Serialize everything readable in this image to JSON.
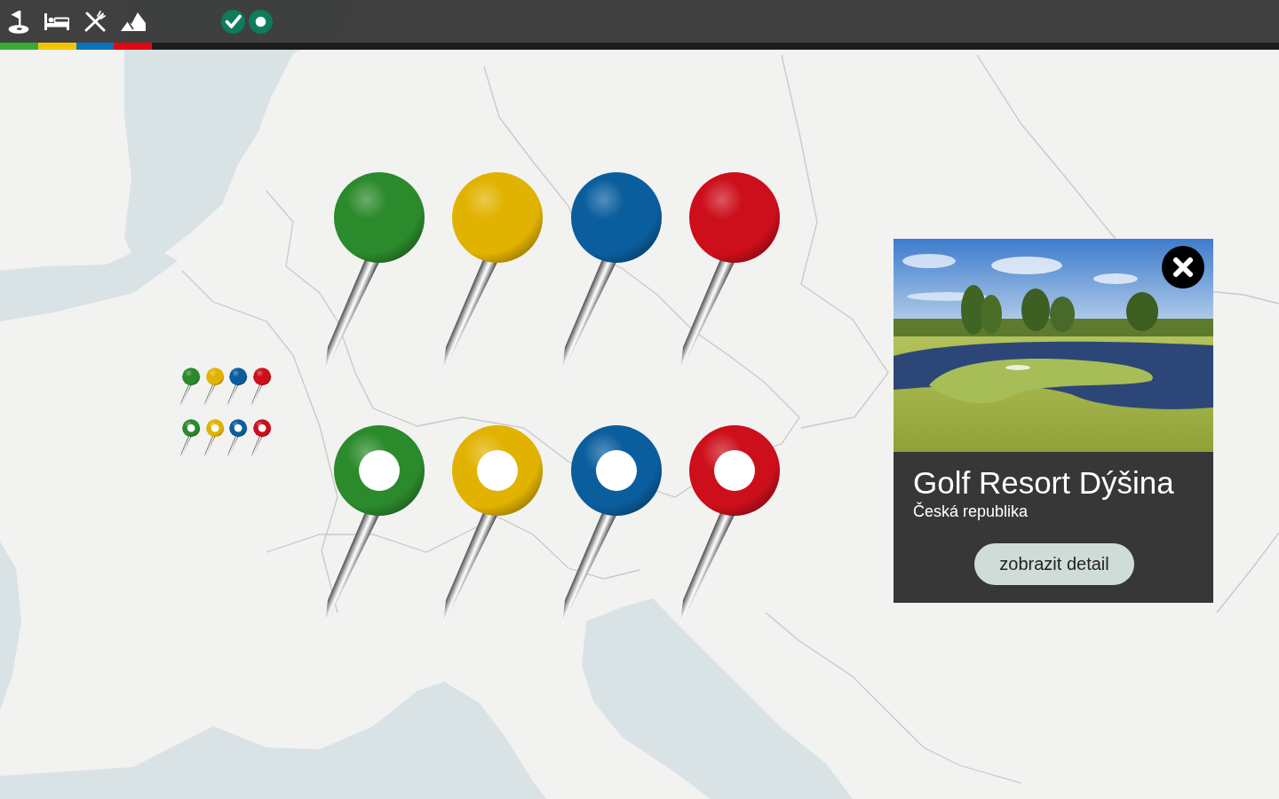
{
  "toolbar": {
    "categories": [
      {
        "kind": "golf",
        "color": "#3aaa35"
      },
      {
        "kind": "hotel",
        "color": "#f5c400"
      },
      {
        "kind": "restaurant",
        "color": "#0b72b9"
      },
      {
        "kind": "mountain",
        "color": "#e30613"
      }
    ],
    "filters": [
      {
        "kind": "check",
        "on": true
      },
      {
        "kind": "dot",
        "on": true
      }
    ]
  },
  "map": {
    "pins": [
      {
        "kind": "solid",
        "color": "#2b8a2b"
      },
      {
        "kind": "solid",
        "color": "#e2b200"
      },
      {
        "kind": "solid",
        "color": "#0a5e9e"
      },
      {
        "kind": "solid",
        "color": "#cc0f1b"
      },
      {
        "kind": "ring",
        "color": "#2b8a2b"
      },
      {
        "kind": "ring",
        "color": "#e2b200"
      },
      {
        "kind": "ring",
        "color": "#0a5e9e"
      },
      {
        "kind": "ring",
        "color": "#cc0f1b"
      }
    ],
    "legend_pins": [
      {
        "kind": "solid",
        "color": "#2b8a2b"
      },
      {
        "kind": "solid",
        "color": "#e2b200"
      },
      {
        "kind": "solid",
        "color": "#0a5e9e"
      },
      {
        "kind": "solid",
        "color": "#cc0f1b"
      },
      {
        "kind": "ring",
        "color": "#2b8a2b"
      },
      {
        "kind": "ring",
        "color": "#e2b200"
      },
      {
        "kind": "ring",
        "color": "#0a5e9e"
      },
      {
        "kind": "ring",
        "color": "#cc0f1b"
      }
    ]
  },
  "popup": {
    "title": "Golf Resort Dýšina",
    "subtitle": "Česká republika",
    "button": "zobrazit detail"
  }
}
